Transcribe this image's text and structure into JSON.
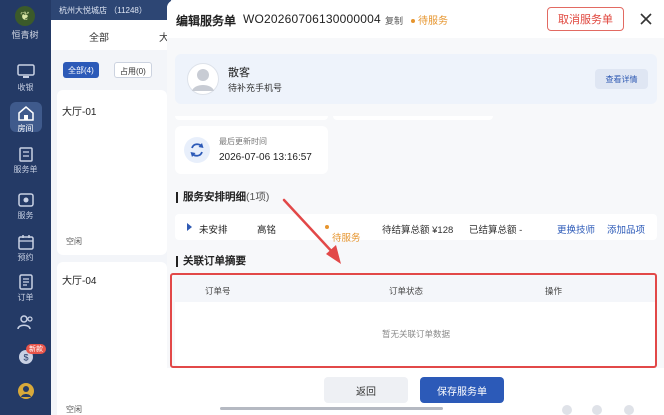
{
  "nav": {
    "logo": "恒青树",
    "items": [
      {
        "label": "收银",
        "icon": "cashier-icon"
      },
      {
        "label": "房间",
        "icon": "room-icon"
      },
      {
        "label": "服务单",
        "icon": "service-order-icon"
      },
      {
        "label": "服务",
        "icon": "service-icon"
      },
      {
        "label": "预约",
        "icon": "booking-icon"
      },
      {
        "label": "订单",
        "icon": "order-icon"
      },
      {
        "label": "人员",
        "icon": "staff-icon"
      }
    ],
    "badge": "新款"
  },
  "background": {
    "store": "杭州大悦城店 （11248）",
    "tab_all": "全部",
    "tab_partial": "大",
    "filter_all": "全部(4)",
    "filter_occupied": "占用(0)",
    "room1": "大厅-01",
    "room2": "大厅-04",
    "idle": "空闲"
  },
  "header": {
    "title": "编辑服务单",
    "order_no": "WO20260706130000004",
    "copy": "复制",
    "status": "待服务",
    "cancel": "取消服务单"
  },
  "customer": {
    "name": "散客",
    "phone_hint": "待补充手机号",
    "detail_btn": "查看详情"
  },
  "update": {
    "label": "最后更新时间",
    "time": "2026-07-06 13:16:57"
  },
  "service": {
    "section_title": "服务安排明细",
    "count": "(1项)",
    "row": {
      "arrange": "未安排",
      "technician": "高铭",
      "status": "待服务",
      "pending": "待结算总额 ¥128",
      "settled": "已结算总额 -",
      "change_tech": "更换技师",
      "add_item": "添加品项"
    }
  },
  "orders": {
    "section_title": "关联订单摘要",
    "columns": [
      "订单号",
      "订单状态",
      "操作"
    ],
    "empty": "暂无关联订单数据"
  },
  "footer": {
    "back": "返回",
    "save": "保存服务单"
  },
  "colors": {
    "primary": "#2c5ab8",
    "warning": "#e6952e",
    "danger": "#e0463d",
    "nav_bg": "#243a66"
  }
}
